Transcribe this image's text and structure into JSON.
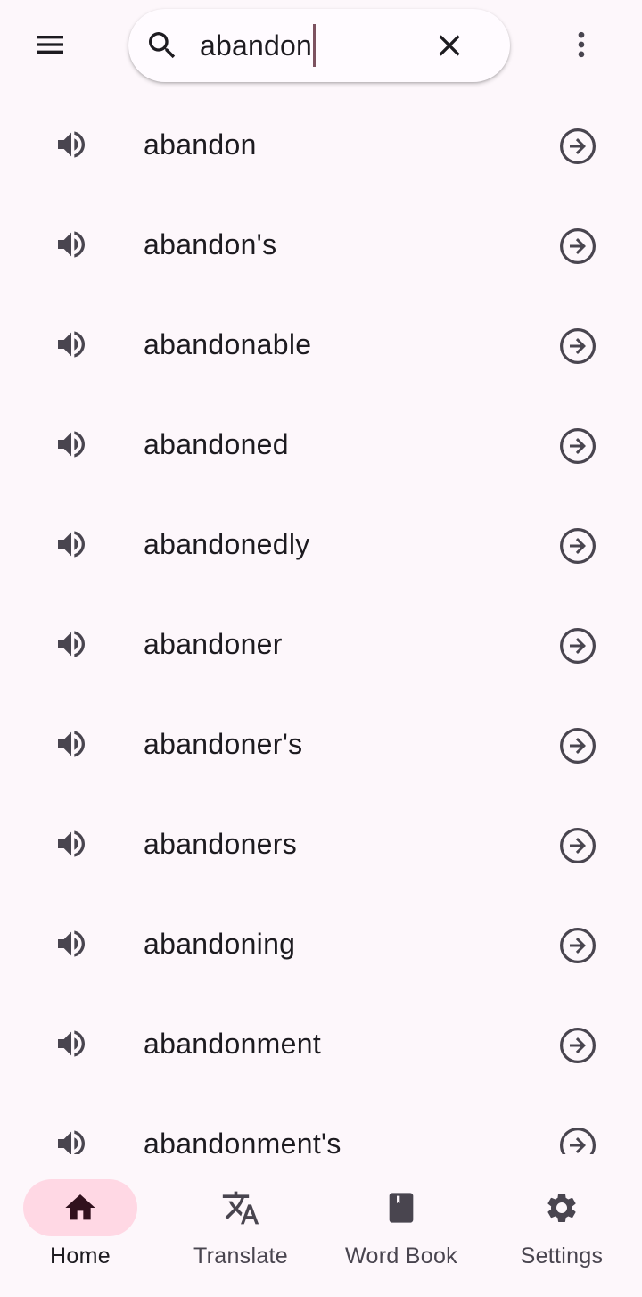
{
  "search": {
    "value": "abandon"
  },
  "words": [
    {
      "word": "abandon"
    },
    {
      "word": "abandon's"
    },
    {
      "word": "abandonable"
    },
    {
      "word": "abandoned"
    },
    {
      "word": "abandonedly"
    },
    {
      "word": "abandoner"
    },
    {
      "word": "abandoner's"
    },
    {
      "word": "abandoners"
    },
    {
      "word": "abandoning"
    },
    {
      "word": "abandonment"
    },
    {
      "word": "abandonment's"
    }
  ],
  "bottom_nav": {
    "items": [
      {
        "label": "Home",
        "icon": "home-icon",
        "active": true
      },
      {
        "label": "Translate",
        "icon": "translate-icon",
        "active": false
      },
      {
        "label": "Word Book",
        "icon": "book-icon",
        "active": false
      },
      {
        "label": "Settings",
        "icon": "gear-icon",
        "active": false
      }
    ]
  },
  "colors": {
    "background": "#fdf7fb",
    "active_pill": "#ffd8e4",
    "caret": "#7d5260",
    "icon": "#49454f"
  }
}
